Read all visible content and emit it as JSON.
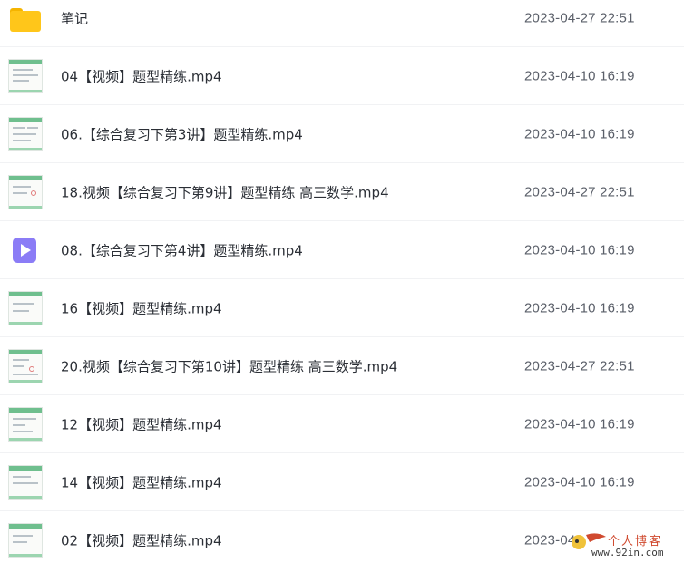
{
  "files": [
    {
      "type": "folder",
      "name": "笔记",
      "date": "2023-04-27 22:51"
    },
    {
      "type": "video",
      "name": "04【视频】题型精练.mp4",
      "date": "2023-04-10 16:19"
    },
    {
      "type": "video",
      "name": "06.【综合复习下第3讲】题型精练.mp4",
      "date": "2023-04-10 16:19"
    },
    {
      "type": "video",
      "name": "18.视频【综合复习下第9讲】题型精练 高三数学.mp4",
      "date": "2023-04-27 22:51"
    },
    {
      "type": "video-generic",
      "name": "08.【综合复习下第4讲】题型精练.mp4",
      "date": "2023-04-10 16:19"
    },
    {
      "type": "video",
      "name": "16【视频】题型精练.mp4",
      "date": "2023-04-10 16:19"
    },
    {
      "type": "video",
      "name": "20.视频【综合复习下第10讲】题型精练 高三数学.mp4",
      "date": "2023-04-27 22:51"
    },
    {
      "type": "video",
      "name": "12【视频】题型精练.mp4",
      "date": "2023-04-10 16:19"
    },
    {
      "type": "video",
      "name": "14【视频】题型精练.mp4",
      "date": "2023-04-10 16:19"
    },
    {
      "type": "video",
      "name": "02【视频】题型精练.mp4",
      "date": "2023-04"
    }
  ],
  "watermark": {
    "text": "个人博客",
    "url": "www.92in.com"
  },
  "colors": {
    "folder": "#ffc61a",
    "play_icon": "#8b7cf6",
    "thumb_accent": "#6fbf8e"
  }
}
